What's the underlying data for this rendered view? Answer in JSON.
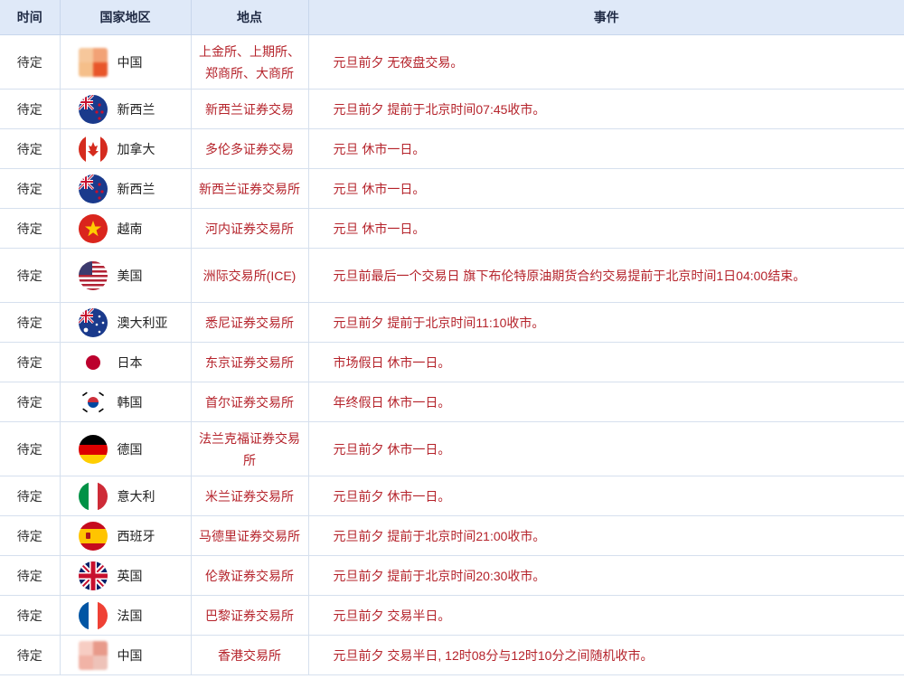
{
  "headers": {
    "time": "时间",
    "country": "国家地区",
    "place": "地点",
    "event": "事件"
  },
  "rows": [
    {
      "time": "待定",
      "country": "中国",
      "flag": "china-flag-icon-blurred",
      "place": "上金所、上期所、郑商所、大商所",
      "event": "元旦前夕 无夜盘交易。"
    },
    {
      "time": "待定",
      "country": "新西兰",
      "flag": "new-zealand-flag-icon",
      "place": "新西兰证券交易",
      "event": "元旦前夕 提前于北京时间07:45收市。"
    },
    {
      "time": "待定",
      "country": "加拿大",
      "flag": "canada-flag-icon",
      "place": "多伦多证券交易",
      "event": "元旦 休市一日。"
    },
    {
      "time": "待定",
      "country": "新西兰",
      "flag": "new-zealand-flag-icon",
      "place": "新西兰证券交易所",
      "event": "元旦 休市一日。"
    },
    {
      "time": "待定",
      "country": "越南",
      "flag": "vietnam-flag-icon",
      "place": "河内证券交易所",
      "event": "元旦 休市一日。"
    },
    {
      "time": "待定",
      "country": "美国",
      "flag": "usa-flag-icon",
      "place": "洲际交易所(ICE)",
      "event": "元旦前最后一个交易日 旗下布伦特原油期货合约交易提前于北京时间1日04:00结束。"
    },
    {
      "time": "待定",
      "country": "澳大利亚",
      "flag": "australia-flag-icon",
      "place": "悉尼证券交易所",
      "event": "元旦前夕 提前于北京时间11:10收市。"
    },
    {
      "time": "待定",
      "country": "日本",
      "flag": "japan-flag-icon",
      "place": "东京证券交易所",
      "event": "市场假日 休市一日。"
    },
    {
      "time": "待定",
      "country": "韩国",
      "flag": "korea-flag-icon",
      "place": "首尔证券交易所",
      "event": "年终假日 休市一日。"
    },
    {
      "time": "待定",
      "country": "德国",
      "flag": "germany-flag-icon",
      "place": "法兰克福证券交易所",
      "event": "元旦前夕 休市一日。"
    },
    {
      "time": "待定",
      "country": "意大利",
      "flag": "italy-flag-icon",
      "place": "米兰证券交易所",
      "event": "元旦前夕 休市一日。"
    },
    {
      "time": "待定",
      "country": "西班牙",
      "flag": "spain-flag-icon",
      "place": "马德里证券交易所",
      "event": "元旦前夕 提前于北京时间21:00收市。"
    },
    {
      "time": "待定",
      "country": "英国",
      "flag": "uk-flag-icon",
      "place": "伦敦证券交易所",
      "event": "元旦前夕 提前于北京时间20:30收市。"
    },
    {
      "time": "待定",
      "country": "法国",
      "flag": "france-flag-icon",
      "place": "巴黎证券交易所",
      "event": "元旦前夕 交易半日。"
    },
    {
      "time": "待定",
      "country": "中国",
      "flag": "china-flag-icon-blurred",
      "place": "香港交易所",
      "event": "元旦前夕 交易半日, 12时08分与12时10分之间随机收市。"
    }
  ],
  "colors": {
    "header_bg": "#dfe9f8",
    "accent_red": "#b5232b",
    "border": "#d6e0ee"
  }
}
